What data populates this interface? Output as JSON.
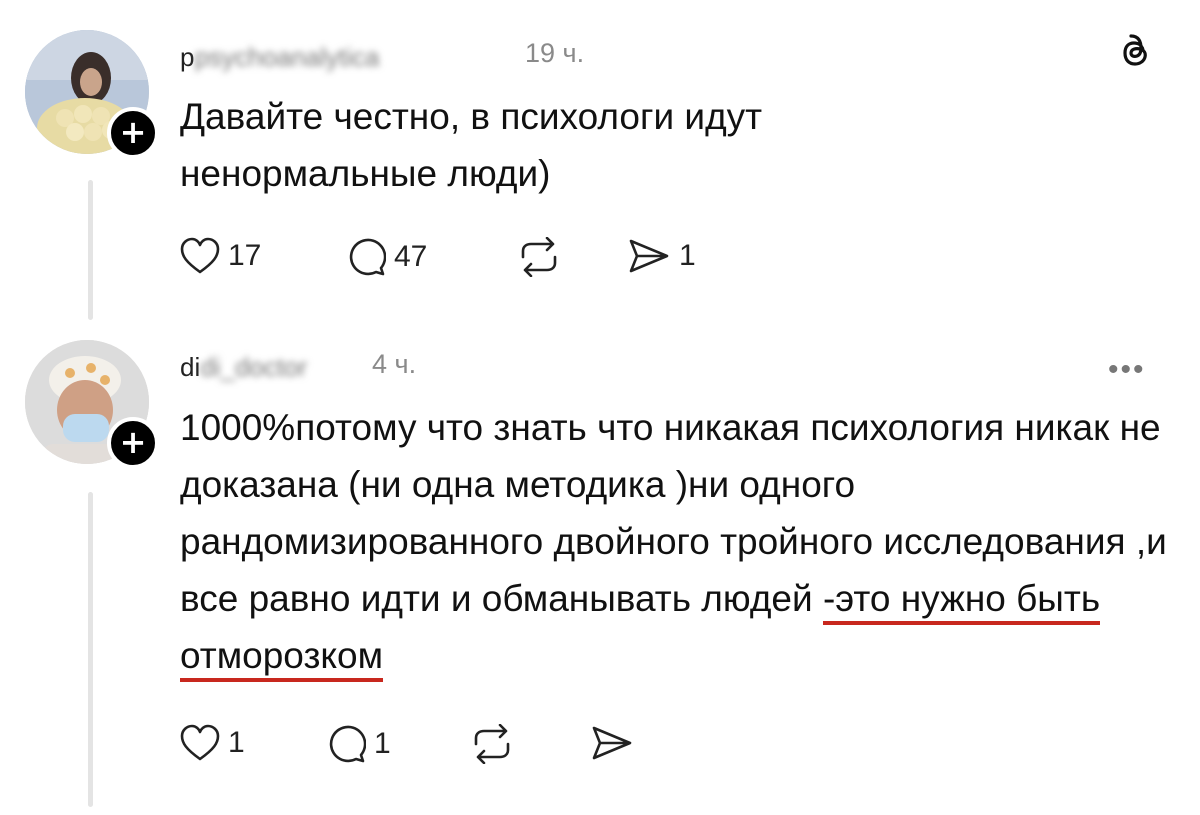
{
  "posts": [
    {
      "username": "psychoanalytica",
      "time": "19 ч.",
      "text": "Давайте честно, в психологи идут ненормальные люди)",
      "likes": "17",
      "comments": "47",
      "shares": "1"
    },
    {
      "username": "di_doctor",
      "time": "4 ч.",
      "text_plain": "1000%потому что знать что никакая психология никак не доказана (ни одна методика )ни одного рандомизированного двойного тройного исследования ,и все равно идти и обманывать людей ",
      "text_underlined": "-это нужно быть отморозком",
      "likes": "1",
      "comments": "1",
      "more": "•••"
    }
  ],
  "icons": {
    "threads": "threads-logo-icon",
    "like": "heart-icon",
    "comment": "comment-bubble-icon",
    "repost": "repost-icon",
    "share": "send-icon",
    "follow": "plus-icon"
  },
  "colors": {
    "underline": "#c8281e",
    "meta": "#8a8a8a",
    "thread_line": "#e4e4e4"
  }
}
